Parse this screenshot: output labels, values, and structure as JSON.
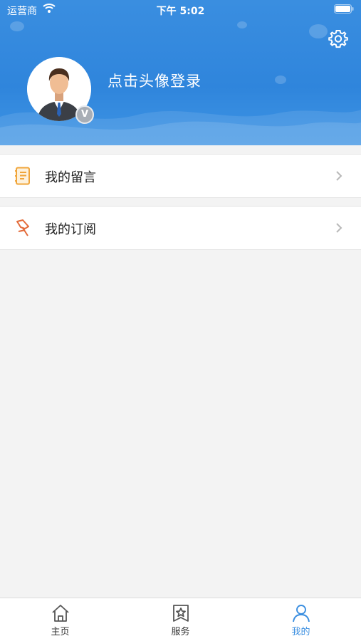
{
  "status_bar": {
    "carrier": "运营商",
    "time": "下午 5:02"
  },
  "profile": {
    "login_prompt": "点击头像登录",
    "badge_letter": "V"
  },
  "menu": {
    "items": [
      {
        "label": "我的留言",
        "icon": "notebook-icon"
      },
      {
        "label": "我的订阅",
        "icon": "pushpin-icon"
      }
    ]
  },
  "tabbar": {
    "tabs": [
      {
        "label": "主页",
        "icon": "home-icon",
        "active": false
      },
      {
        "label": "服务",
        "icon": "star-bookmark-icon",
        "active": false
      },
      {
        "label": "我的",
        "icon": "person-icon",
        "active": true
      }
    ]
  },
  "colors": {
    "accent": "#3a8ee0",
    "menu_icon": "#f0a53a"
  }
}
